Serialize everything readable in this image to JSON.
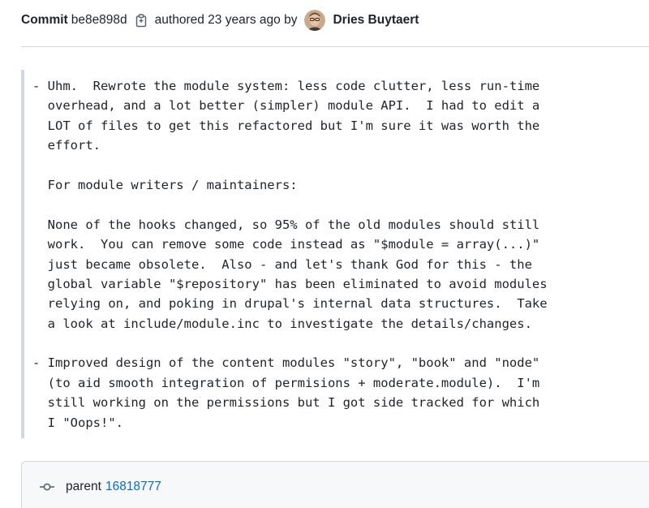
{
  "header": {
    "commit_label": "Commit",
    "sha": "be8e898d",
    "copy_icon": "copy-icon",
    "authored_text": "authored 23 years ago by",
    "author_name": "Dries Buytaert"
  },
  "message": {
    "lines": [
      "- Uhm.  Rewrote the module system: less code clutter, less run-time",
      "  overhead, and a lot better (simpler) module API.  I had to edit a",
      "  LOT of files to get this refactored but I'm sure it was worth the",
      "  effort.",
      "",
      "  For module writers / maintainers:",
      "",
      "  None of the hooks changed, so 95% of the old modules should still",
      "  work.  You can remove some code instead as \"$module = array(...)\"",
      "  just became obsolete.  Also - and let's thank God for this - the",
      "  global variable \"$repository\" has been eliminated to avoid modules",
      "  relying on, and poking in drupal's internal data structures.  Take",
      "  a look at include/module.inc to investigate the details/changes.",
      "",
      "- Improved design of the content modules \"story\", \"book\" and \"node\"",
      "  (to aid smooth integration of permisions + moderate.module).  I'm",
      "  still working on the permissions but I got side tracked for which",
      "  I \"Oops!\"."
    ]
  },
  "parents": {
    "icon": "git-commit-icon",
    "label": "parent",
    "sha": "16818777"
  },
  "colors": {
    "link": "#0969da",
    "border": "#d0d7de",
    "panel_bg": "#f6f8fa"
  }
}
